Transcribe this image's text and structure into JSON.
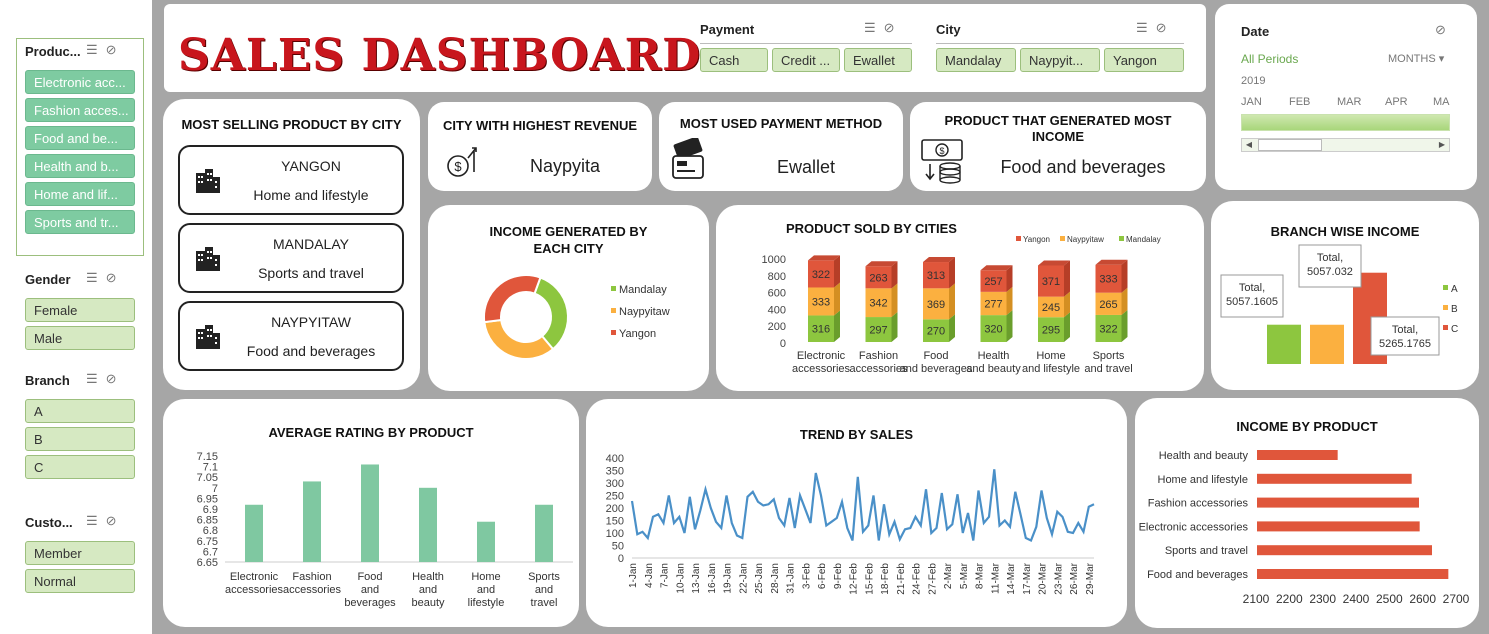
{
  "title": "SALES DASHBOARD",
  "slicers": {
    "product": {
      "title": "Produc...",
      "items": [
        "Electronic acc...",
        "Fashion acces...",
        "Food and be...",
        "Health and b...",
        "Home and lif...",
        "Sports and tr..."
      ]
    },
    "gender": {
      "title": "Gender",
      "items": [
        "Female",
        "Male"
      ]
    },
    "branch": {
      "title": "Branch",
      "items": [
        "A",
        "B",
        "C"
      ]
    },
    "customer": {
      "title": "Custo...",
      "items": [
        "Member",
        "Normal"
      ]
    },
    "payment": {
      "title": "Payment",
      "items": [
        "Cash",
        "Credit ...",
        "Ewallet"
      ]
    },
    "city": {
      "title": "City",
      "items": [
        "Mandalay",
        "Naypyit...",
        "Yangon"
      ]
    }
  },
  "date_filter": {
    "title": "Date",
    "all_periods": "All Periods",
    "unit": "MONTHS",
    "year": "2019",
    "months": [
      "JAN",
      "FEB",
      "MAR",
      "APR",
      "MA"
    ]
  },
  "most_selling": {
    "title": "MOST SELLING PRODUCT BY CITY",
    "cities": [
      {
        "city": "YANGON",
        "product": "Home and lifestyle"
      },
      {
        "city": "MANDALAY",
        "product": "Sports and travel"
      },
      {
        "city": "NAYPYITAW",
        "product": "Food and beverages"
      }
    ]
  },
  "kpis": {
    "highest_revenue": {
      "title": "CITY WITH HIGHEST REVENUE",
      "value": "Naypyita"
    },
    "payment_method": {
      "title": "MOST USED PAYMENT METHOD",
      "value": "Ewallet"
    },
    "top_product": {
      "title": "PRODUCT THAT GENERATED MOST INCOME",
      "value": "Food and beverages"
    }
  },
  "colors": {
    "green": "#8dc63f",
    "orange": "#fbb040",
    "red": "#e0563b",
    "teal": "#7fc8a1",
    "blue": "#4a90c8",
    "slicer_sel": "#7ecba1"
  },
  "chart_data": [
    {
      "type": "pie",
      "title": "INCOME GENERATED BY EACH CITY",
      "categories": [
        "Mandalay",
        "Naypyitaw",
        "Yangon"
      ],
      "values": [
        33.3,
        34.2,
        32.5
      ]
    },
    {
      "type": "bar",
      "title": "PRODUCT SOLD BY CITIES",
      "stacked": true,
      "categories": [
        "Electronic accessories",
        "Fashion accessories",
        "Food and beverages",
        "Health and beauty",
        "Home and lifestyle",
        "Sports and travel"
      ],
      "series": [
        {
          "name": "Mandalay",
          "values": [
            316,
            297,
            270,
            320,
            295,
            322
          ]
        },
        {
          "name": "Naypyitaw",
          "values": [
            333,
            342,
            369,
            277,
            245,
            265
          ]
        },
        {
          "name": "Yangon",
          "values": [
            322,
            263,
            313,
            257,
            371,
            333
          ]
        }
      ],
      "yticks": [
        "1000",
        "800",
        "600",
        "400",
        "200",
        "0"
      ],
      "ylim": [
        0,
        1000
      ],
      "legend": "top-right"
    },
    {
      "type": "bar",
      "title": "BRANCH WISE INCOME",
      "categories": [
        "A",
        "B",
        "C"
      ],
      "values": [
        5057.1605,
        5057.032,
        5265.1765
      ],
      "labels": [
        "Total, 5057.1605",
        "Total, 5057.032",
        "Total, 5265.1765"
      ],
      "legend": "right"
    },
    {
      "type": "bar",
      "title": "AVERAGE RATING BY PRODUCT",
      "categories": [
        "Electronic accessories",
        "Fashion accessories",
        "Food and beverages",
        "Health and beauty",
        "Home and lifestyle",
        "Sports and travel"
      ],
      "values": [
        6.92,
        7.03,
        7.11,
        7.0,
        6.84,
        6.92
      ],
      "yticks": [
        "7.15",
        "7.1",
        "7.05",
        "7",
        "6.95",
        "6.9",
        "6.85",
        "6.8",
        "6.75",
        "6.7",
        "6.65"
      ],
      "ylim": [
        6.65,
        7.15
      ]
    },
    {
      "type": "line",
      "title": "TREND BY SALES",
      "x": [
        "1-Jan",
        "2-Jan",
        "3-Jan",
        "4-Jan",
        "5-Jan",
        "6-Jan",
        "7-Jan",
        "8-Jan",
        "9-Jan",
        "10-Jan",
        "11-Jan",
        "12-Jan",
        "13-Jan",
        "14-Jan",
        "15-Jan",
        "16-Jan",
        "17-Jan",
        "18-Jan",
        "19-Jan",
        "20-Jan",
        "21-Jan",
        "22-Jan",
        "23-Jan",
        "24-Jan",
        "25-Jan",
        "26-Jan",
        "27-Jan",
        "28-Jan",
        "29-Jan",
        "30-Jan",
        "31-Jan",
        "1-Feb",
        "2-Feb",
        "3-Feb",
        "4-Feb",
        "5-Feb",
        "6-Feb",
        "7-Feb",
        "8-Feb",
        "9-Feb",
        "10-Feb",
        "11-Feb",
        "12-Feb",
        "13-Feb",
        "14-Feb",
        "15-Feb",
        "16-Feb",
        "17-Feb",
        "18-Feb",
        "19-Feb",
        "20-Feb",
        "21-Feb",
        "22-Feb",
        "23-Feb",
        "24-Feb",
        "25-Feb",
        "26-Feb",
        "27-Feb",
        "28-Feb",
        "1-Mar",
        "2-Mar",
        "3-Mar",
        "4-Mar",
        "5-Mar",
        "6-Mar",
        "7-Mar",
        "8-Mar",
        "9-Mar",
        "10-Mar",
        "11-Mar",
        "12-Mar",
        "13-Mar",
        "14-Mar",
        "15-Mar",
        "16-Mar",
        "17-Mar",
        "18-Mar",
        "19-Mar",
        "20-Mar",
        "21-Mar",
        "22-Mar",
        "23-Mar",
        "24-Mar",
        "25-Mar",
        "26-Mar",
        "27-Mar",
        "28-Mar",
        "29-Mar",
        "30-Mar"
      ],
      "tick_labels": [
        "1-Jan",
        "4-Jan",
        "7-Jan",
        "10-Jan",
        "13-Jan",
        "16-Jan",
        "19-Jan",
        "22-Jan",
        "25-Jan",
        "28-Jan",
        "31-Jan",
        "3-Feb",
        "6-Feb",
        "9-Feb",
        "12-Feb",
        "15-Feb",
        "18-Feb",
        "21-Feb",
        "24-Feb",
        "27-Feb",
        "2-Mar",
        "5-Mar",
        "8-Mar",
        "11-Mar",
        "14-Mar",
        "17-Mar",
        "20-Mar",
        "23-Mar",
        "26-Mar",
        "29-Mar"
      ],
      "values": [
        228,
        95,
        105,
        80,
        165,
        175,
        140,
        250,
        140,
        165,
        100,
        245,
        115,
        190,
        275,
        200,
        145,
        120,
        250,
        140,
        90,
        80,
        245,
        265,
        225,
        210,
        215,
        235,
        160,
        130,
        240,
        120,
        250,
        195,
        140,
        340,
        250,
        130,
        145,
        160,
        225,
        120,
        70,
        325,
        105,
        130,
        250,
        70,
        215,
        95,
        145,
        75,
        115,
        120,
        165,
        130,
        275,
        100,
        120,
        260,
        115,
        135,
        255,
        100,
        180,
        70,
        270,
        140,
        165,
        355,
        130,
        150,
        125,
        265,
        175,
        80,
        70,
        125,
        270,
        160,
        95,
        185,
        165,
        105,
        100,
        140,
        105,
        205,
        215
      ],
      "yticks": [
        "400",
        "350",
        "300",
        "250",
        "200",
        "150",
        "100",
        "50",
        "0"
      ],
      "ylim": [
        0,
        400
      ]
    },
    {
      "type": "bar",
      "title": "INCOME BY PRODUCT",
      "orientation": "horizontal",
      "categories": [
        "Health and beauty",
        "Home and lifestyle",
        "Fashion accessories",
        "Electronic accessories",
        "Sports and travel",
        "Food and beverages"
      ],
      "values": [
        2342,
        2564,
        2586,
        2588,
        2625,
        2674
      ],
      "xticks": [
        "2100",
        "2200",
        "2300",
        "2400",
        "2500",
        "2600",
        "2700"
      ],
      "xlim": [
        2100,
        2700
      ]
    }
  ]
}
